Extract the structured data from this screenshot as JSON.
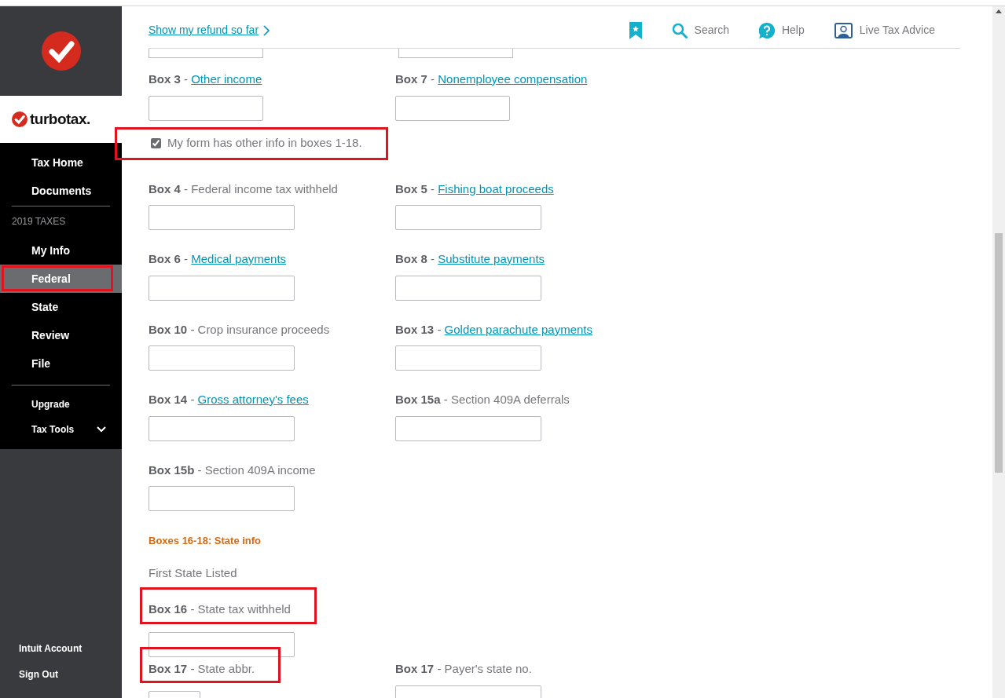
{
  "sidebar": {
    "brand": "turbotax.",
    "top_items": [
      {
        "label": "Tax Home",
        "selected": false,
        "highlighted": false
      },
      {
        "label": "Documents",
        "selected": false,
        "highlighted": false
      }
    ],
    "section_title": "2019 TAXES",
    "items": [
      {
        "label": "My Info",
        "selected": false,
        "highlighted": false
      },
      {
        "label": "Federal",
        "selected": true,
        "highlighted": true
      },
      {
        "label": "State",
        "selected": false,
        "highlighted": false
      },
      {
        "label": "Review",
        "selected": false,
        "highlighted": false
      },
      {
        "label": "File",
        "selected": false,
        "highlighted": false
      }
    ],
    "extra_items": [
      {
        "label": "Upgrade"
      },
      {
        "label": "Tax Tools",
        "expanded": false
      }
    ],
    "bottom_items": [
      "Intuit Account",
      "Sign Out"
    ]
  },
  "header": {
    "refund_link": "Show my refund so far",
    "tools": [
      {
        "kind": "bookmark"
      },
      {
        "kind": "search",
        "label": "Search"
      },
      {
        "kind": "help",
        "label": "Help"
      },
      {
        "kind": "advice",
        "label": "Live Tax Advice"
      }
    ]
  },
  "form": {
    "rows_before": [
      [
        {
          "box": "Box 3",
          "separator": "-",
          "label": "Other income",
          "kind": "link",
          "highlighted": false
        },
        {
          "box": "Box 7",
          "separator": "-",
          "label": "Nonemployee compensation",
          "kind": "link",
          "highlighted": false
        }
      ]
    ],
    "checkbox": {
      "label": "My form has other info in boxes 1-18.",
      "checked": true,
      "highlighted": true
    },
    "rows": [
      [
        {
          "box": "Box 4",
          "separator": "-",
          "label": "Federal income tax withheld",
          "kind": "plain",
          "highlighted": false
        },
        {
          "box": "Box 5",
          "separator": "-",
          "label": "Fishing boat proceeds",
          "kind": "link",
          "highlighted": false
        }
      ],
      [
        {
          "box": "Box 6",
          "separator": "-",
          "label": "Medical payments",
          "kind": "link",
          "highlighted": false
        },
        {
          "box": "Box 8",
          "separator": "-",
          "label": "Substitute payments",
          "kind": "link",
          "highlighted": false
        }
      ],
      [
        {
          "box": "Box 10",
          "separator": "-",
          "label": "Crop insurance proceeds",
          "kind": "plain",
          "highlighted": false
        },
        {
          "box": "Box 13",
          "separator": "-",
          "label": "Golden parachute payments",
          "kind": "link",
          "highlighted": false
        }
      ],
      [
        {
          "box": "Box 14",
          "separator": "-",
          "label": "Gross attorney's fees",
          "kind": "link",
          "highlighted": false
        },
        {
          "box": "Box 15a",
          "separator": "-",
          "label": "Section 409A deferrals",
          "kind": "plain",
          "highlighted": false
        }
      ],
      [
        {
          "box": "Box 15b",
          "separator": "-",
          "label": "Section 409A income",
          "kind": "plain",
          "highlighted": false
        }
      ]
    ],
    "state_heading": "Boxes 16-18: State info",
    "state_subheading": "First State Listed",
    "state_rows": [
      [
        {
          "box": "Box 16",
          "separator": "-",
          "label": "State tax withheld",
          "kind": "plain",
          "highlighted": true
        }
      ],
      [
        {
          "box": "Box 17",
          "separator": "-",
          "label": "State abbr.",
          "kind": "plain",
          "highlighted": true
        },
        {
          "box": "Box 17",
          "separator": "-",
          "label": "Payer's state no.",
          "kind": "plain",
          "highlighted": false
        }
      ]
    ]
  }
}
